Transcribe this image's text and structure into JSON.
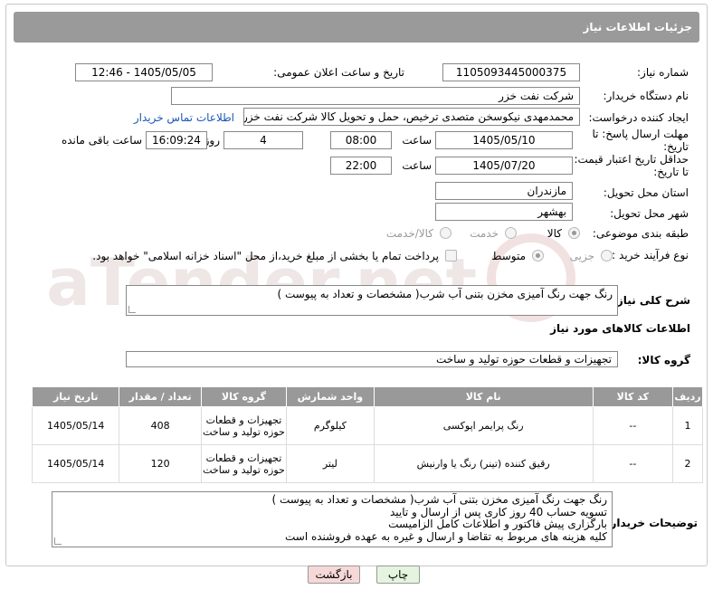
{
  "header": {
    "title": "جزئیات اطلاعات نیاز"
  },
  "watermark": {
    "text": "AriaTender.net"
  },
  "fields": {
    "need_number_label": "شماره نیاز:",
    "need_number": "1105093445000375",
    "announce_label": "تاریخ و ساعت اعلان عمومی:",
    "announce_value": "1405/05/05 - 12:46",
    "buyer_org_label": "نام دستگاه خریدار:",
    "buyer_org": "شرکت نفت خزر",
    "creator_label": "ایجاد کننده درخواست:",
    "creator": "محمدمهدی نیکوسخن متصدی ترخیص، حمل و تحویل کالا شرکت نفت خزر",
    "contact_link": "اطلاعات تماس خریدار",
    "reply_deadline_label": "مهلت ارسال پاسخ: تا تاریخ:",
    "reply_date": "1405/05/10",
    "time_label": "ساعت",
    "reply_time": "08:00",
    "days_value": "4",
    "days_label": "روز و",
    "remaining_time": "16:09:24",
    "remaining_label": "ساعت باقی مانده",
    "validity_label": "حداقل تاریخ اعتبار قیمت: تا تاریخ:",
    "validity_date": "1405/07/20",
    "validity_time": "22:00",
    "province_label": "استان محل تحویل:",
    "province": "مازندران",
    "city_label": "شهر محل تحویل:",
    "city": "بهشهر",
    "category_label": "طبقه بندی موضوعی:",
    "category_options": [
      "کالا",
      "خدمت",
      "کالا/خدمت"
    ],
    "process_label": "نوع فرآیند خرید :",
    "process_options": [
      "جزیی",
      "متوسط"
    ],
    "payment_note": "پرداخت تمام یا بخشی از مبلغ خرید،از محل \"اسناد خزانه اسلامی\" خواهد بود."
  },
  "description": {
    "label": "شرح کلی نیاز:",
    "text": "رنگ جهت رنگ آمیزی مخزن بتنی آب شرب( مشخصات و تعداد به پیوست )"
  },
  "goods_section": {
    "title": "اطلاعات کالاهای مورد نیاز",
    "group_label": "گروه کالا:",
    "group_value": "تجهیزات و قطعات حوزه تولید و ساخت"
  },
  "table": {
    "headers": [
      "ردیف",
      "کد کالا",
      "نام کالا",
      "واحد شمارش",
      "گروه کالا",
      "تعداد / مقدار",
      "تاریخ نیاز"
    ],
    "rows": [
      [
        "1",
        "--",
        "رنگ پرایمر اپوکسی",
        "کیلوگرم",
        "تجهیزات و قطعات حوزه تولید و ساخت",
        "408",
        "1405/05/14"
      ],
      [
        "2",
        "--",
        "رقیق کننده (تینر) رنگ یا وارنیش",
        "لیتر",
        "تجهیزات و قطعات حوزه تولید و ساخت",
        "120",
        "1405/05/14"
      ]
    ]
  },
  "buyer_notes": {
    "label": "توضیحات خریدار:",
    "lines": [
      "رنگ جهت رنگ آمیزی مخزن بتنی آب شرب( مشخصات و تعداد به پیوست )",
      "تسویه حساب 40 روز کاری پس از ارسال و تایید",
      "بارگزاری پیش فاکتور و اطلاعات کامل الزامیست",
      "کلیه هزینه های مربوط به تقاضا و ارسال و غیره به عهده فروشنده است"
    ]
  },
  "buttons": {
    "print": "چاپ",
    "back": "بازگشت"
  },
  "colors": {
    "header_bg": "#9a9a9a",
    "link": "#1a56b8",
    "back_button_bg": "#f6d8d8",
    "print_button_bg": "#e4f4df"
  }
}
